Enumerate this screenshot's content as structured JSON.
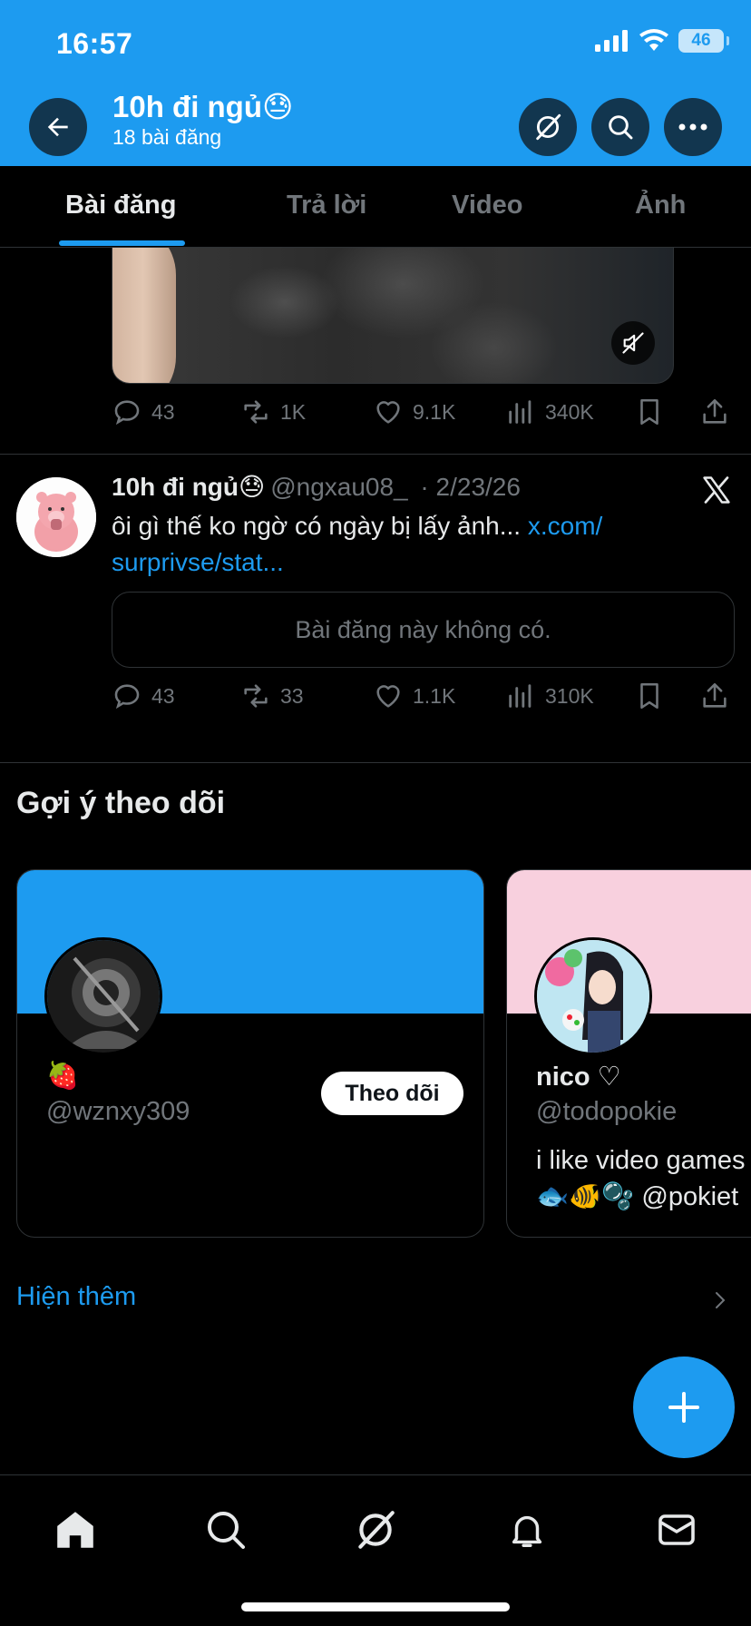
{
  "status_bar": {
    "time": "16:57",
    "battery": "46"
  },
  "header": {
    "title": "10h đi ngủ😓",
    "subtitle": "18 bài đăng"
  },
  "tabs": [
    {
      "label": "Bài đăng",
      "active": true
    },
    {
      "label": "Trả lời",
      "active": false
    },
    {
      "label": "Video",
      "active": false
    },
    {
      "label": "Ảnh",
      "active": false
    }
  ],
  "post1": {
    "replies": "43",
    "reposts": "1K",
    "likes": "9.1K",
    "views": "340K"
  },
  "post2": {
    "name": "10h đi ngủ😓",
    "handle": "@ngxau08_",
    "date": "· 2/23/26",
    "text": "ôi gì thế ko ngờ có ngày bị lấy ảnh...",
    "link_line1": "x.com/",
    "link_line2": "surprivse/stat...",
    "unavailable": "Bài đăng này không có.",
    "replies": "43",
    "reposts": "33",
    "likes": "1.1K",
    "views": "310K"
  },
  "suggestions": {
    "title": "Gợi ý theo dõi",
    "cards": [
      {
        "name": "🍓",
        "handle": "@wznxy309",
        "bio": "",
        "follow_label": "Theo dõi",
        "banner_color": "#1d9bf0"
      },
      {
        "name": "nico ♡",
        "handle": "@todopokie",
        "bio_line1": "i like video games",
        "bio_line2": "🐟🐠🫧 @pokiet",
        "banner_color": "#f8d0de"
      }
    ],
    "show_more": "Hiện thêm"
  },
  "colors": {
    "accent": "#1d9bf0",
    "muted": "#71767b",
    "text": "#e7e9ea",
    "border": "#2f3336"
  }
}
